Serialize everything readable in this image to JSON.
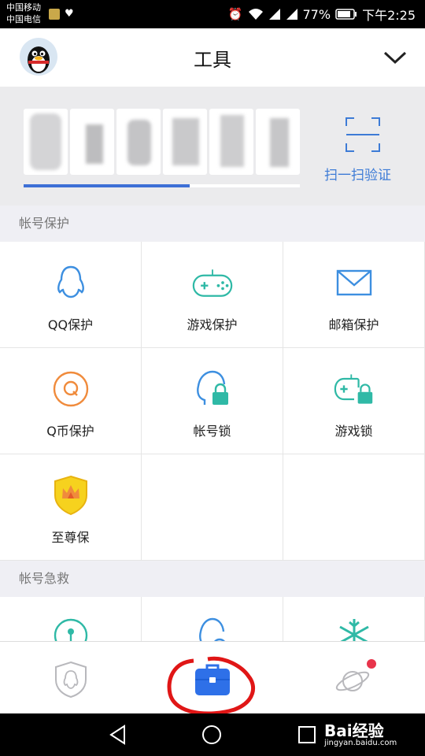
{
  "status_bar": {
    "carrier_1": "中国移动",
    "carrier_2": "中国电信",
    "battery": "77%",
    "time": "下午2:25"
  },
  "header": {
    "title": "工具"
  },
  "token": {
    "scan_label": "扫一扫验证",
    "progress": 0.6
  },
  "sections": [
    {
      "title": "帐号保护",
      "items": [
        {
          "label": "QQ保护",
          "icon": "qq-penguin-icon"
        },
        {
          "label": "游戏保护",
          "icon": "gamepad-icon"
        },
        {
          "label": "邮箱保护",
          "icon": "mail-icon"
        },
        {
          "label": "Q币保护",
          "icon": "q-coin-icon"
        },
        {
          "label": "帐号锁",
          "icon": "user-lock-icon"
        },
        {
          "label": "游戏锁",
          "icon": "game-lock-icon"
        },
        {
          "label": "至尊保",
          "icon": "crown-shield-icon"
        }
      ]
    },
    {
      "title": "帐号急救"
    }
  ],
  "watermark": {
    "brand": "Bai经验",
    "url": "jingyan.baidu.com"
  },
  "colors": {
    "accent": "#3d7bd6",
    "teal": "#2fb9a6",
    "orange": "#f08b3c"
  }
}
